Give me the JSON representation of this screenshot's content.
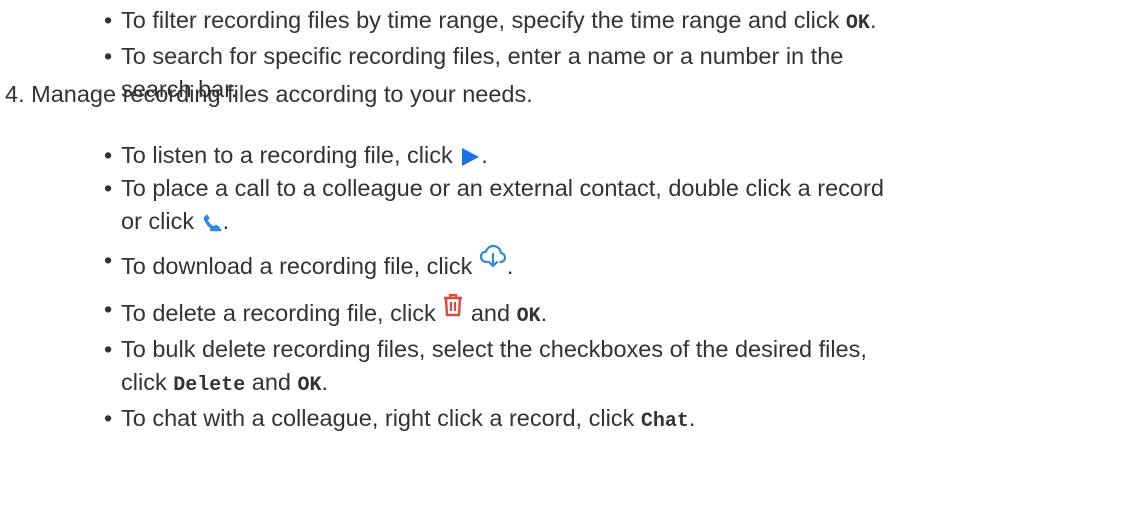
{
  "top_bullets": {
    "filter_text": "To filter recording files by time range, specify the time range and click ",
    "filter_ok": "OK",
    "filter_end": ".",
    "search_line1": "To search for specific recording files, enter a name or a number in the",
    "search_line2": "search bar."
  },
  "step4": "4. Manage recording files according to your needs.",
  "bullets": {
    "listen": "To listen to a recording file, click ",
    "listen_end": ".",
    "call_line1": "To place a call to a colleague or an external contact, double click a record",
    "call_line2": "or click ",
    "call_end": ".",
    "download": "To download a recording file, click ",
    "download_end": ".",
    "delete": "To delete a recording file, click ",
    "delete_and": " and ",
    "delete_ok": "OK",
    "delete_end": ".",
    "bulk_line1": "To bulk delete recording files, select the checkboxes of the desired files,",
    "bulk_click": "click ",
    "bulk_delete": "Delete",
    "bulk_and": " and ",
    "bulk_ok": "OK",
    "bulk_end": ".",
    "chat": "To chat with a colleague, right click a record, click ",
    "chat_code": "Chat",
    "chat_end": "."
  },
  "icons": {
    "play": "play-icon",
    "phone": "phone-icon",
    "download": "cloud-download-icon",
    "delete": "trash-icon"
  },
  "colors": {
    "text": "#333333",
    "play": "#1a73e8",
    "phone": "#2f87e0",
    "download": "#2f87e0",
    "delete": "#e0493a"
  }
}
